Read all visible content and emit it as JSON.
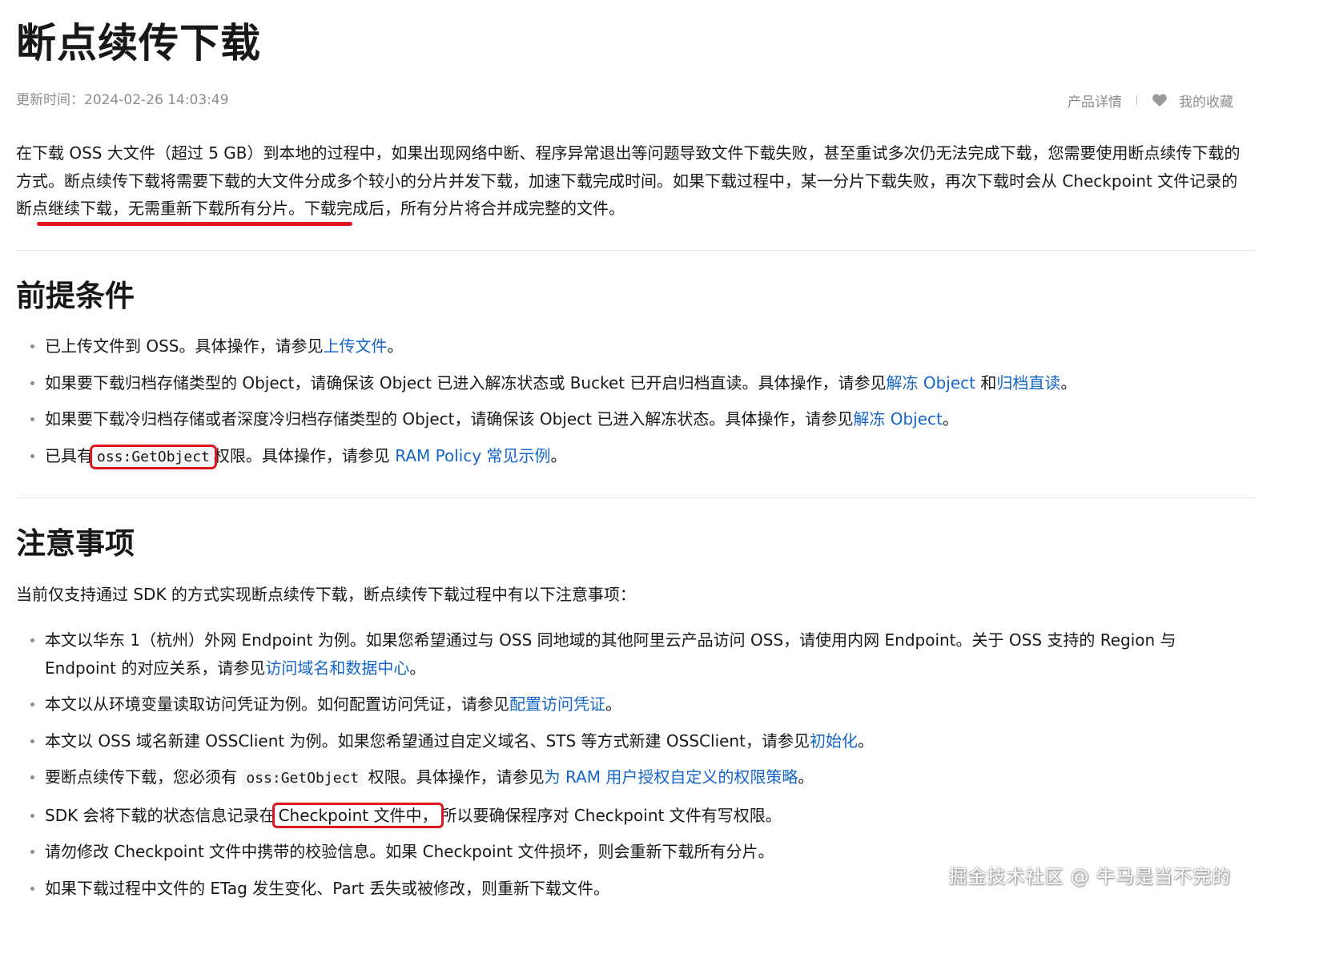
{
  "article": {
    "title": "断点续传下载",
    "update_time": "更新时间：2024-02-26 14:03:49",
    "product_details": "产品详情",
    "favorites": "我的收藏",
    "intro": {
      "part1": "在下载 OSS 大文件（超过 5 GB）到本地的过程中，如果出现网络中断、程序异常退出等问题导致文件下载失败，甚至重试多次仍无法完成下载，您需要使用断点续传下载的方式。断点续传下载将需要下载的大文件分成多个较小的分片并发下载，加速下载完成时间。如果下载过程中，某一分片下载失败，再次下载时会从 Checkpoint 文件",
      "highlight": "记录的断点继续下载，无需重新下载所有分片",
      "part2": "。下载完成后，所有分片将合并成完整的文件。"
    }
  },
  "prereq": {
    "heading": "前提条件",
    "item1": {
      "text": "已上传文件到 OSS。具体操作，请参见",
      "link": "上传文件",
      "end": "。"
    },
    "item2": {
      "text": "如果要下载归档存储类型的 Object，请确保该 Object 已进入解冻状态或 Bucket 已开启归档直读。具体操作，请参见",
      "link1": "解冻 Object",
      "mid": " 和",
      "link2": "归档直读",
      "end": "。"
    },
    "item3": {
      "text": "如果要下载冷归档存储或者深度冷归档存储类型的 Object，请确保该 Object 已进入解冻状态。具体操作，请参见",
      "link": "解冻 Object",
      "end": "。"
    },
    "item4": {
      "pre": "已具有",
      "code": "oss:GetObject",
      "text": "权限。具体操作，请参见 ",
      "link": "RAM Policy 常见示例",
      "end": "。"
    }
  },
  "notes": {
    "heading": "注意事项",
    "intro": "当前仅支持通过 SDK 的方式实现断点续传下载，断点续传下载过程中有以下注意事项：",
    "item1": {
      "text": "本文以华东 1（杭州）外网 Endpoint 为例。如果您希望通过与 OSS 同地域的其他阿里云产品访问 OSS，请使用内网 Endpoint。关于 OSS 支持的 Region 与 Endpoint 的对应关系，请参见",
      "link": "访问域名和数据中心",
      "end": "。"
    },
    "item2": {
      "text": "本文以从环境变量读取访问凭证为例。如何配置访问凭证，请参见",
      "link": "配置访问凭证",
      "end": "。"
    },
    "item3": {
      "text": "本文以 OSS 域名新建 OSSClient 为例。如果您希望通过自定义域名、STS 等方式新建 OSSClient，请参见",
      "link": "初始化",
      "end": "。"
    },
    "item4": {
      "pre": "要断点续传下载，您必须有 ",
      "code": "oss:GetObject",
      "text": " 权限。具体操作，请参见",
      "link": "为 RAM 用户授权自定义的权限策略",
      "end": "。"
    },
    "item5": {
      "pre": "SDK 会将下载的状态信息记录在",
      "boxed": "Checkpoint 文件中，",
      "text": "所以要确保程序对 Checkpoint 文件有写权限。"
    },
    "item6": {
      "text": "请勿修改 Checkpoint 文件中携带的校验信息。如果 Checkpoint 文件损坏，则会重新下载所有分片。"
    },
    "item7": {
      "text": "如果下载过程中文件的 ETag 发生变化、Part 丢失或被修改，则重新下载文件。"
    }
  },
  "watermark": "掘金技术社区 @ 牛马是当不完的",
  "icons": {
    "heart": "heart-icon"
  },
  "colors": {
    "link": "#1466c8",
    "highlight_red": "#e0151e",
    "muted": "#8c8c8c",
    "text": "#181818"
  }
}
